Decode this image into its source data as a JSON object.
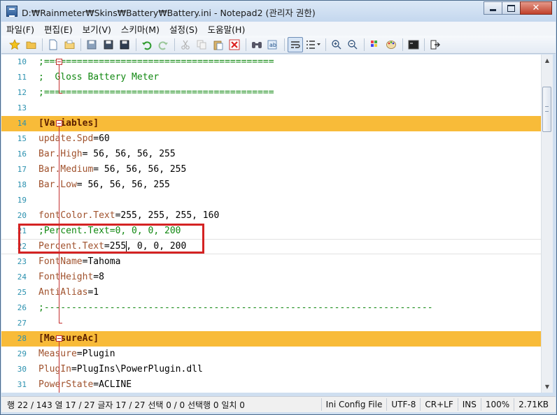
{
  "window": {
    "title": "D:₩Rainmeter₩Skins₩Battery₩Battery.ini - Notepad2 (관리자 권한)",
    "minimize_label": "",
    "maximize_label": "",
    "close_label": "✕"
  },
  "menu": [
    "파일(F)",
    "편집(E)",
    "보기(V)",
    "스키마(M)",
    "설정(S)",
    "도움말(H)"
  ],
  "toolbar_icons": [
    "star-icon",
    "open-folder-icon",
    "new-file-icon",
    "open-file-icon",
    "save-icon",
    "save-as-icon",
    "save-copy-icon",
    "undo-icon",
    "redo-icon",
    "cut-icon",
    "copy-icon",
    "paste-icon",
    "delete-icon",
    "find-icon",
    "replace-icon",
    "word-wrap-icon",
    "list-icon",
    "zoom-in-icon",
    "zoom-out-icon",
    "scheme-icon",
    "colors-icon",
    "terminal-icon",
    "exit-icon"
  ],
  "editor": {
    "lines": [
      {
        "n": "10",
        "parts": [
          {
            "t": ";==========================================",
            "c": "comment"
          }
        ]
      },
      {
        "n": "11",
        "parts": [
          {
            "t": ";  Gloss Battery Meter",
            "c": "comment"
          }
        ]
      },
      {
        "n": "12",
        "parts": [
          {
            "t": ";==========================================",
            "c": "comment"
          }
        ]
      },
      {
        "n": "13",
        "parts": []
      },
      {
        "n": "14",
        "section": true,
        "parts": [
          {
            "t": "[Variables]",
            "c": "section"
          }
        ]
      },
      {
        "n": "15",
        "parts": [
          {
            "t": "update.Spd",
            "c": "key"
          },
          {
            "t": "=",
            "c": "eq"
          },
          {
            "t": "60",
            "c": "val"
          }
        ]
      },
      {
        "n": "16",
        "parts": [
          {
            "t": "Bar.High",
            "c": "key"
          },
          {
            "t": "=",
            "c": "eq"
          },
          {
            "t": " 56, 56, 56, 255",
            "c": "val"
          }
        ]
      },
      {
        "n": "17",
        "parts": [
          {
            "t": "Bar.Medium",
            "c": "key"
          },
          {
            "t": "=",
            "c": "eq"
          },
          {
            "t": " 56, 56, 56, 255",
            "c": "val"
          }
        ]
      },
      {
        "n": "18",
        "parts": [
          {
            "t": "Bar.Low",
            "c": "key"
          },
          {
            "t": "=",
            "c": "eq"
          },
          {
            "t": " 56, 56, 56, 255",
            "c": "val"
          }
        ]
      },
      {
        "n": "19",
        "parts": []
      },
      {
        "n": "20",
        "parts": [
          {
            "t": "fontColor.Text",
            "c": "key"
          },
          {
            "t": "=",
            "c": "eq"
          },
          {
            "t": "255, 255, 255, 160",
            "c": "val"
          }
        ]
      },
      {
        "n": "21",
        "parts": [
          {
            "t": ";Percent.Text=0, 0, 0, 200",
            "c": "comment"
          }
        ]
      },
      {
        "n": "22",
        "current": true,
        "parts": [
          {
            "t": "Percent.Text",
            "c": "key"
          },
          {
            "t": "=",
            "c": "eq"
          },
          {
            "t": "255, 0, 0, 200",
            "c": "val"
          }
        ]
      },
      {
        "n": "23",
        "parts": [
          {
            "t": "FontName",
            "c": "key"
          },
          {
            "t": "=",
            "c": "eq"
          },
          {
            "t": "Tahoma",
            "c": "val"
          }
        ]
      },
      {
        "n": "24",
        "parts": [
          {
            "t": "FontHeight",
            "c": "key"
          },
          {
            "t": "=",
            "c": "eq"
          },
          {
            "t": "8",
            "c": "val"
          }
        ]
      },
      {
        "n": "25",
        "parts": [
          {
            "t": "AntiAlias",
            "c": "key"
          },
          {
            "t": "=",
            "c": "eq"
          },
          {
            "t": "1",
            "c": "val"
          }
        ]
      },
      {
        "n": "26",
        "parts": [
          {
            "t": ";-----------------------------------------------------------------------",
            "c": "comment"
          }
        ]
      },
      {
        "n": "27",
        "parts": []
      },
      {
        "n": "28",
        "section": true,
        "parts": [
          {
            "t": "[MeasureAc]",
            "c": "section"
          }
        ]
      },
      {
        "n": "29",
        "parts": [
          {
            "t": "Measure",
            "c": "key"
          },
          {
            "t": "=",
            "c": "eq"
          },
          {
            "t": "Plugin",
            "c": "val"
          }
        ]
      },
      {
        "n": "30",
        "parts": [
          {
            "t": "PlugIn",
            "c": "key"
          },
          {
            "t": "=",
            "c": "eq"
          },
          {
            "t": "PlugIns\\PowerPlugin.dll",
            "c": "val"
          }
        ]
      },
      {
        "n": "31",
        "parts": [
          {
            "t": "PowerState",
            "c": "key"
          },
          {
            "t": "=",
            "c": "eq"
          },
          {
            "t": "ACLINE",
            "c": "val"
          }
        ]
      }
    ]
  },
  "status": {
    "position": "행 22 / 143  열 17 / 27  글자 17 / 27  선택 0 / 0  선택행 0  일치 0",
    "scheme": "Ini Config File",
    "encoding": "UTF-8",
    "eol": "CR+LF",
    "mode": "INS",
    "zoom": "100%",
    "size": "2.71KB"
  }
}
